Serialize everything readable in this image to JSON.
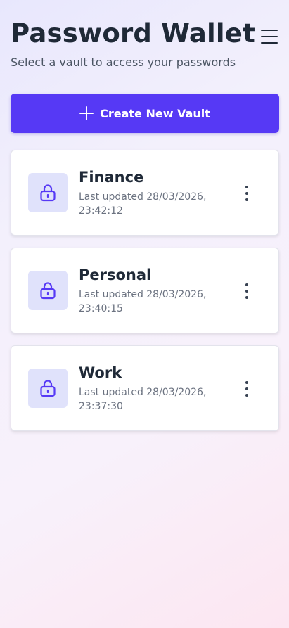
{
  "header": {
    "title": "Password Wallet",
    "subtitle": "Select a vault to access your passwords",
    "menu_icon": "hamburger-menu-icon"
  },
  "actions": {
    "create_label": "Create New Vault",
    "create_icon": "plus-icon"
  },
  "vaults": [
    {
      "name": "Finance",
      "updated": "Last updated 28/03/2026, 23:42:12",
      "icon": "lock-icon",
      "menu_icon": "more-vertical-icon"
    },
    {
      "name": "Personal",
      "updated": "Last updated 28/03/2026, 23:40:15",
      "icon": "lock-icon",
      "menu_icon": "more-vertical-icon"
    },
    {
      "name": "Work",
      "updated": "Last updated 28/03/2026, 23:37:30",
      "icon": "lock-icon",
      "menu_icon": "more-vertical-icon"
    }
  ],
  "colors": {
    "accent": "#5639f5",
    "icon_bg": "#e0e2fb",
    "title_text": "#1f2937",
    "muted_text": "#6b7280"
  }
}
